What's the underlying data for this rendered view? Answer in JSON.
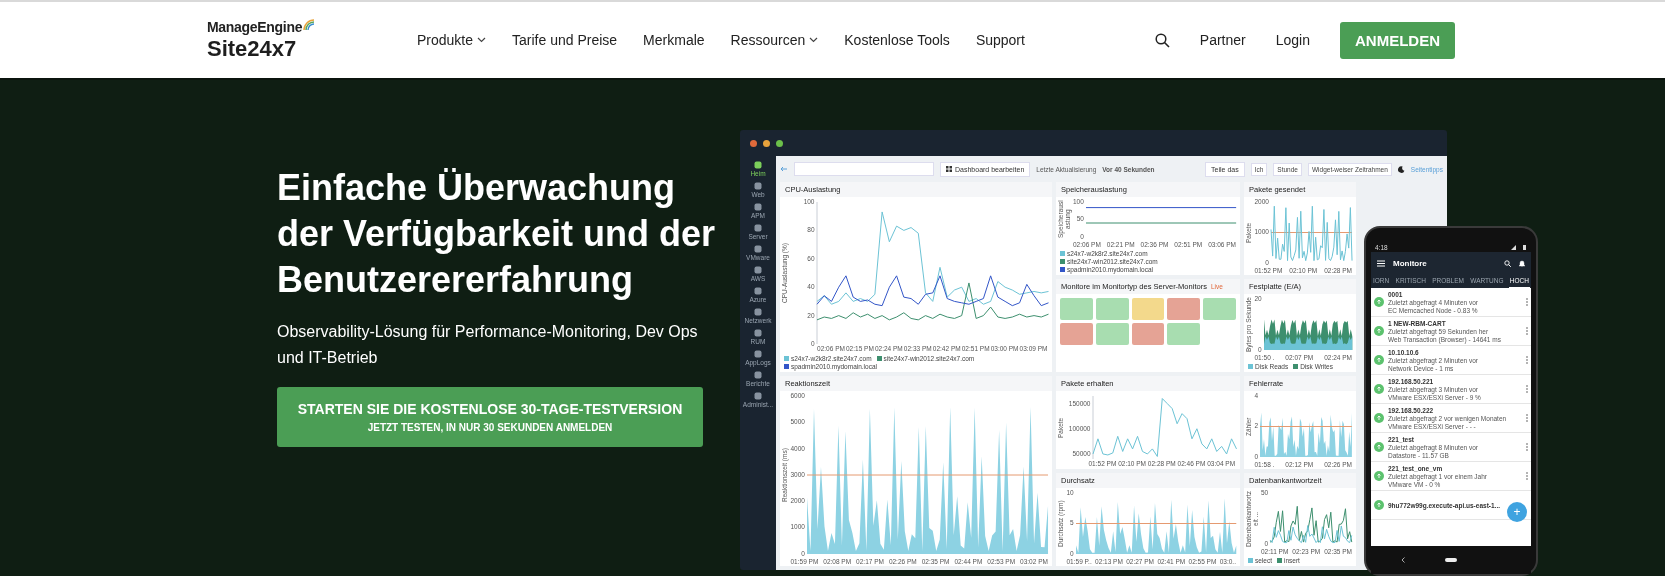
{
  "header": {
    "logo_top": "ManageEngine",
    "logo_bottom": "Site24x7",
    "nav": [
      {
        "label": "Produkte",
        "dropdown": true
      },
      {
        "label": "Tarife und Preise",
        "dropdown": false
      },
      {
        "label": "Merkmale",
        "dropdown": false
      },
      {
        "label": "Ressourcen",
        "dropdown": true
      },
      {
        "label": "Kostenlose Tools",
        "dropdown": false
      },
      {
        "label": "Support",
        "dropdown": false
      }
    ],
    "links": [
      "Partner",
      "Login"
    ],
    "cta": "ANMELDEN"
  },
  "hero": {
    "heading": "Einfache Überwachung der Verfügbarkeit und der Benutzerererfahrung",
    "subtitle": "Observability-Lösung für Performance-Monitoring, Dev Ops und IT-Betrieb",
    "cta_title": "STARTEN SIE DIE KOSTENLOSE 30-TAGE-TESTVERSION",
    "cta_subtitle": "JETZT TESTEN, IN NUR 30 SEKUNDEN ANMELDEN"
  },
  "dashboard": {
    "sidebar": [
      {
        "label": "Heim",
        "selected": true
      },
      {
        "label": "Web",
        "selected": false
      },
      {
        "label": "APM",
        "selected": false
      },
      {
        "label": "Server",
        "selected": false
      },
      {
        "label": "VMware",
        "selected": false
      },
      {
        "label": "AWS",
        "selected": false
      },
      {
        "label": "Azure",
        "selected": false
      },
      {
        "label": "Netzwerk",
        "selected": false
      },
      {
        "label": "RUM",
        "selected": false
      },
      {
        "label": "AppLogs",
        "selected": false
      },
      {
        "label": "Berichte",
        "selected": false
      },
      {
        "label": "Administ...",
        "selected": false
      }
    ],
    "toolbar": {
      "edit_button": "Dashboard bearbeiten",
      "refresh_label": "Letzte Aktualisierung",
      "refresh_value": "Vor 40 Sekunden",
      "share_button": "Teile das",
      "period_options": [
        "Ich",
        "Stunde"
      ],
      "timeframe_select": "Widget-weiser Zeitrahmen",
      "tips_link": "Seitentipps"
    },
    "panels": [
      {
        "title": "CPU-Auslastung",
        "chart_data": {
          "type": "line",
          "ylabel": "CPU-Auslastung (%)",
          "categories": [
            null,
            null,
            "02:06 PM",
            null,
            null,
            null,
            "02:15 PM",
            null,
            null,
            null,
            "02:24 PM",
            null,
            null,
            null,
            "02:33 PM",
            null,
            null,
            null,
            "02:42 PM",
            null,
            null,
            null,
            "02:51 PM",
            null,
            null,
            null,
            "03:00 PM",
            null,
            null,
            null,
            "03:09 PM",
            null,
            null
          ],
          "series": [
            {
              "name": "s24x7-w2k8r2.site24x7.com",
              "color": "#6cc3d5",
              "values": [
                30,
                34,
                28,
                30,
                36,
                30,
                32,
                30,
                35,
                93,
                72,
                83,
                80,
                82,
                78,
                36,
                30,
                54,
                33,
                38,
                40,
                30,
                32,
                28,
                30,
                44,
                40,
                38,
                35,
                36,
                37,
                36,
                37
              ]
            },
            {
              "name": "site24x7-win2012.site24x7.com",
              "color": "#3d8f6e",
              "values": [
                17,
                19,
                18,
                20,
                18,
                22,
                19,
                21,
                18,
                20,
                17,
                19,
                22,
                18,
                17,
                20,
                18,
                21,
                19,
                18,
                20,
                43,
                18,
                20,
                26,
                19,
                18,
                19,
                21,
                19,
                20,
                19,
                21
              ]
            },
            {
              "name": "spadmin2010.mydomain.local",
              "color": "#3356c8",
              "values": [
                28,
                34,
                30,
                40,
                48,
                33,
                30,
                31,
                28,
                27,
                40,
                48,
                33,
                32,
                28,
                35,
                36,
                48,
                32,
                30,
                29,
                28,
                30,
                32,
                48,
                33,
                30,
                27,
                29,
                42,
                34,
                27,
                29
              ]
            }
          ],
          "ylim": [
            0,
            100
          ],
          "yticks": [
            0,
            20,
            40,
            60,
            80,
            100
          ]
        }
      },
      {
        "title": "Speicherauslastung",
        "kind": "flat",
        "ylabel": "Speicherauslastung",
        "yticks": [
          "100",
          "50",
          "0"
        ],
        "xticks": [
          "02:06 PM",
          "02:21 PM",
          "02:36 PM",
          "02:51 PM",
          "03:06 PM"
        ],
        "legend": [
          {
            "label": "s24x7-w2k8r2.site24x7.com",
            "color": "#6cc3d5"
          },
          {
            "label": "site24x7-win2012.site24x7.com",
            "color": "#3d8f6e"
          },
          {
            "label": "spadmin2010.mydomain.local",
            "color": "#3356c8"
          }
        ]
      },
      {
        "title": "Pakete gesendet",
        "kind": "spikes",
        "ylabel": "Pakete",
        "yticks": [
          "2000",
          "1000",
          "0"
        ],
        "xticks": [
          "01:52 PM",
          "02:10 PM",
          "02:28 PM"
        ]
      },
      {
        "title": "Monitore im Monitortyp des Server-Monitors",
        "kind": "tiles",
        "badge": "Live",
        "tiles": [
          {
            "color": "#a8ddb0"
          },
          {
            "color": "#a8ddb0"
          },
          {
            "color": "#f3d98c"
          },
          {
            "color": "#e5a395"
          },
          {
            "color": "#a8ddb0"
          },
          {
            "color": "#e5a395"
          },
          {
            "color": "#a8ddb0"
          },
          {
            "color": "#e5a395"
          },
          {
            "color": "#a8ddb0"
          }
        ]
      },
      {
        "title": "Festplatte (E/A)",
        "kind": "stacked",
        "ylabel": "Bytes pro Sekunde",
        "yticks": [
          "20",
          "0"
        ],
        "xticks": [
          "01:50 .",
          "02:07 PM",
          "02:24 PM"
        ],
        "legend": [
          {
            "label": "Disk Reads",
            "color": "#6cc3d5"
          },
          {
            "label": "Disk Writes",
            "color": "#3d8f6e"
          }
        ]
      },
      {
        "title": "Reaktionszeit",
        "kind": "area",
        "ylabel": "Reaktionszeit (ms)",
        "yticks": [
          "6000",
          "5000",
          "4000",
          "3000",
          "2000",
          "1000",
          "0"
        ],
        "xticks": [
          "01:59 PM",
          "02:08 PM",
          "02:17 PM",
          "02:26 PM",
          "02:35 PM",
          "02:44 PM",
          "02:53 PM",
          "03:02 PM"
        ]
      },
      {
        "title": "Pakete erhalten",
        "chart_data": {
          "type": "line",
          "ylabel": "Pakete",
          "categories": [
            null,
            null,
            "01:52 PM",
            null,
            null,
            null,
            null,
            null,
            "02:10 PM",
            null,
            null,
            null,
            null,
            null,
            "02:28 PM",
            null,
            null,
            null,
            null,
            null,
            "02:46 PM",
            null,
            null,
            null,
            null,
            null,
            "03:04 PM",
            null,
            null,
            null
          ],
          "series": [
            {
              "color": "#6cc3d5",
              "values": [
                50000,
                80000,
                50000,
                48000,
                52000,
                85000,
                55000,
                80000,
                60000,
                85000,
                55000,
                50000,
                60000,
                45000,
                160000,
                150000,
                140000,
                110000,
                130000,
                120000,
                80000,
                100000,
                70000,
                60000,
                80000,
                55000,
                65000,
                50000,
                80000,
                60000
              ]
            }
          ],
          "ylim": [
            40000,
            165000
          ],
          "yticks": [
            50000,
            100000,
            150000
          ]
        }
      },
      {
        "title": "Fehlerrate",
        "kind": "area",
        "ylabel": "Zähler",
        "yticks": [
          "4",
          "2",
          "0"
        ],
        "xticks": [
          "01:58 .",
          "02:12 PM",
          "02:26 PM"
        ]
      },
      {
        "title": "Durchsatz",
        "kind": "area",
        "ylabel": "Durchsatz (rpm)",
        "yticks": [
          "10",
          "5",
          "0"
        ],
        "xticks": [
          "01:59 P..",
          "02:13 PM",
          "02:27 PM",
          "02:41 PM",
          "02:55 PM",
          "03:0.."
        ]
      },
      {
        "title": "Datenbankantwortzeit",
        "kind": "line2",
        "ylabel": "Datenbankantwortzeit ...",
        "yticks": [
          "50",
          "0"
        ],
        "xticks": [
          "02:11 PM",
          "02:23 PM",
          "02:35 PM"
        ],
        "legend": [
          {
            "label": "select",
            "color": "#6cc3d5"
          },
          {
            "label": "insert",
            "color": "#3d8f6e"
          }
        ]
      }
    ]
  },
  "phone": {
    "time": "4:18",
    "title": "Monitore",
    "tabs": [
      {
        "label": "IORN",
        "selected": false
      },
      {
        "label": "KRITISCH",
        "selected": false
      },
      {
        "label": "PROBLEM",
        "selected": false
      },
      {
        "label": "WARTUNG",
        "selected": false
      },
      {
        "label": "HOCH",
        "selected": true
      }
    ],
    "items": [
      {
        "name": "0001",
        "status": "Zuletzt abgefragt 4 Minuten vor",
        "detail": "EC Memcached Node - 0.83 %"
      },
      {
        "name": "1 NEW-RBM-CART",
        "status": "Zuletzt abgefragt 59 Sekunden her",
        "detail": "Web Transaction (Browser) - 14641 ms"
      },
      {
        "name": "10.10.10.6",
        "status": "Zuletzt abgefragt 2 Minuten vor",
        "detail": "Network Device - 1 ms"
      },
      {
        "name": "192.168.50.221",
        "status": "Zuletzt abgefragt 3 Minuten vor",
        "detail": "VMware ESX/ESXi Server - 9 %"
      },
      {
        "name": "192.168.50.222",
        "status": "Zuletzt abgefragt 2 vor wenigen Monaten",
        "detail": "VMware ESX/ESXi Server - - -"
      },
      {
        "name": "221_test",
        "status": "Zuletzt abgefragt 8 Minuten vor",
        "detail": "Datastore - 11.57 GB"
      },
      {
        "name": "221_test_one_vm",
        "status": "Zuletzt abgefragt 1 vor einem Jahr",
        "detail": "VMware VM - 0 %"
      },
      {
        "name": "9hu772w99g.execute-api.us-east-1..."
      }
    ],
    "fab": "+"
  }
}
